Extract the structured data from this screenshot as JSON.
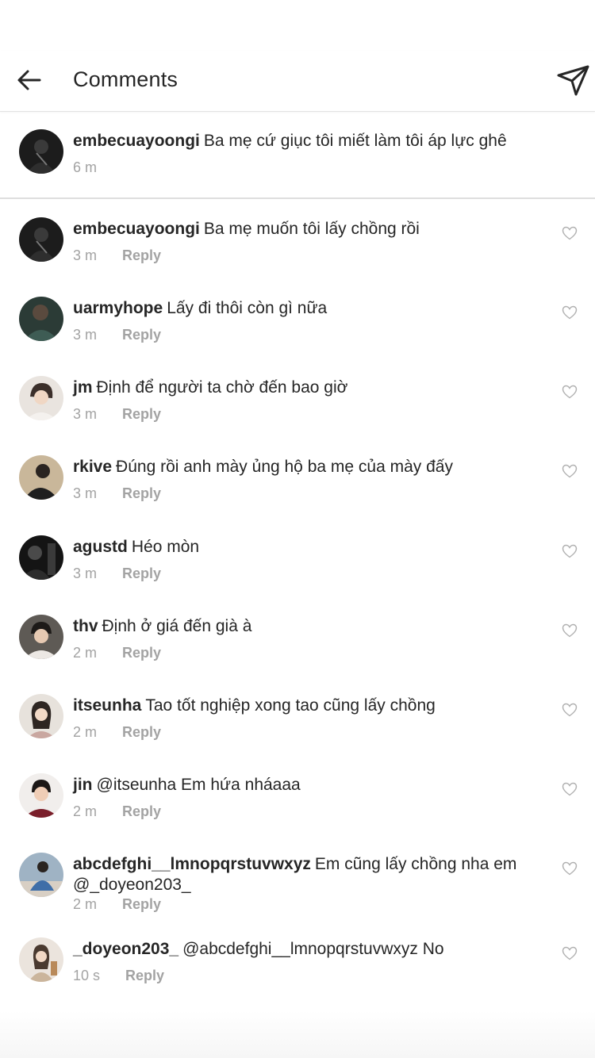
{
  "header": {
    "title": "Comments",
    "back_icon": "arrow-left-icon",
    "send_icon": "paper-plane-icon"
  },
  "caption": {
    "username": "embecuayoongi",
    "text": "Ba mẹ cứ giục tôi miết làm tôi áp lực ghê",
    "time": "6 m"
  },
  "comments": [
    {
      "username": "embecuayoongi",
      "text": "Ba mẹ muốn tôi lấy chồng rồi",
      "time": "3 m",
      "reply": "Reply"
    },
    {
      "username": "uarmyhope",
      "text": "Lấy đi thôi còn gì nữa",
      "time": "3 m",
      "reply": "Reply"
    },
    {
      "username": "jm",
      "text": "Định để người ta chờ đến bao giờ",
      "time": "3 m",
      "reply": "Reply"
    },
    {
      "username": "rkive",
      "text": "Đúng rồi anh mày ủng hộ ba mẹ của mày đấy",
      "time": "3 m",
      "reply": "Reply"
    },
    {
      "username": "agustd",
      "text": "Héo mòn",
      "time": "3 m",
      "reply": "Reply"
    },
    {
      "username": "thv",
      "text": "Định ở giá đến già à",
      "time": "2 m",
      "reply": "Reply"
    },
    {
      "username": "itseunha",
      "text": "Tao tốt nghiệp xong tao cũng lấy chồng",
      "time": "2 m",
      "reply": "Reply"
    },
    {
      "username": "jin",
      "text": "@itseunha Em hứa nháaaa",
      "time": "2 m",
      "reply": "Reply"
    },
    {
      "username": "abcdefghi__lmnopqrstuvwxyz",
      "text": "Em cũng lấy chồng nha em @_doyeon203_",
      "time": "2 m",
      "reply": "Reply"
    },
    {
      "username": "_doyeon203_",
      "text": "@abcdefghi__lmnopqrstuvwxyz No",
      "time": "10 s",
      "reply": "Reply"
    }
  ],
  "colors": {
    "text": "#262626",
    "secondary": "#a3a3a3",
    "divider": "#dedede"
  }
}
